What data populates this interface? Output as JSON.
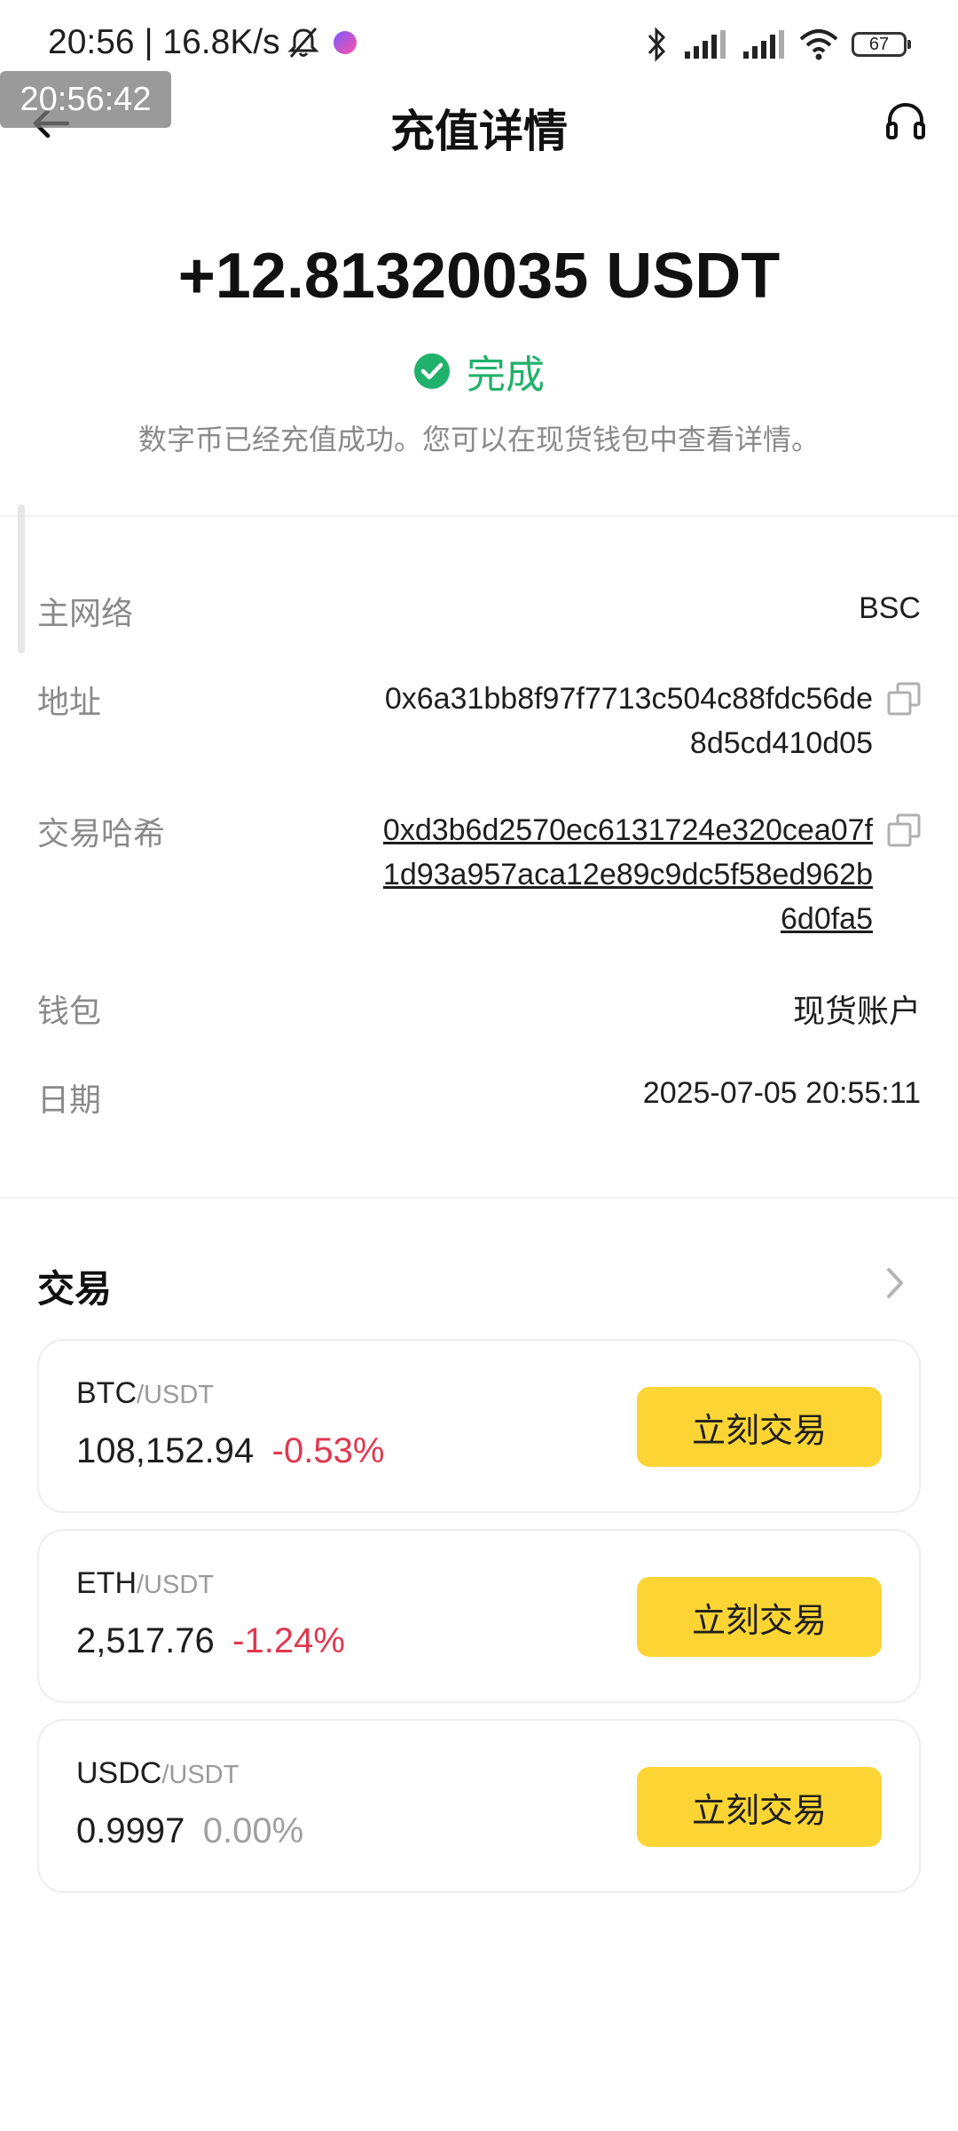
{
  "status_bar": {
    "time": "20:56",
    "net_speed": "16.8K/s",
    "battery": "67"
  },
  "overlay_time": "20:56:42",
  "header": {
    "title": "充值详情"
  },
  "summary": {
    "amount": "+12.81320035 USDT",
    "status": "完成",
    "description": "数字币已经充值成功。您可以在现货钱包中查看详情。"
  },
  "details": {
    "network_label": "主网络",
    "network_value": "BSC",
    "address_label": "地址",
    "address_value": "0x6a31bb8f97f7713c504c88fdc56de8d5cd410d05",
    "txhash_label": "交易哈希",
    "txhash_value": "0xd3b6d2570ec6131724e320cea07f1d93a957aca12e89c9dc5f58ed962b6d0fa5",
    "wallet_label": "钱包",
    "wallet_value": "现货账户",
    "date_label": "日期",
    "date_value": "2025-07-05 20:55:11"
  },
  "trade": {
    "section_title": "交易",
    "button_label": "立刻交易",
    "pairs": [
      {
        "base": "BTC",
        "quote": "/USDT",
        "price": "108,152.94",
        "change": "-0.53%"
      },
      {
        "base": "ETH",
        "quote": "/USDT",
        "price": "2,517.76",
        "change": "-1.24%"
      },
      {
        "base": "USDC",
        "quote": "/USDT",
        "price": "0.9997",
        "change": "0.00%"
      }
    ]
  },
  "colors": {
    "accent_yellow": "#fcd535",
    "success_green": "#20b26c",
    "negative_red": "#e0384f",
    "muted_gray": "#8a8a8a"
  }
}
